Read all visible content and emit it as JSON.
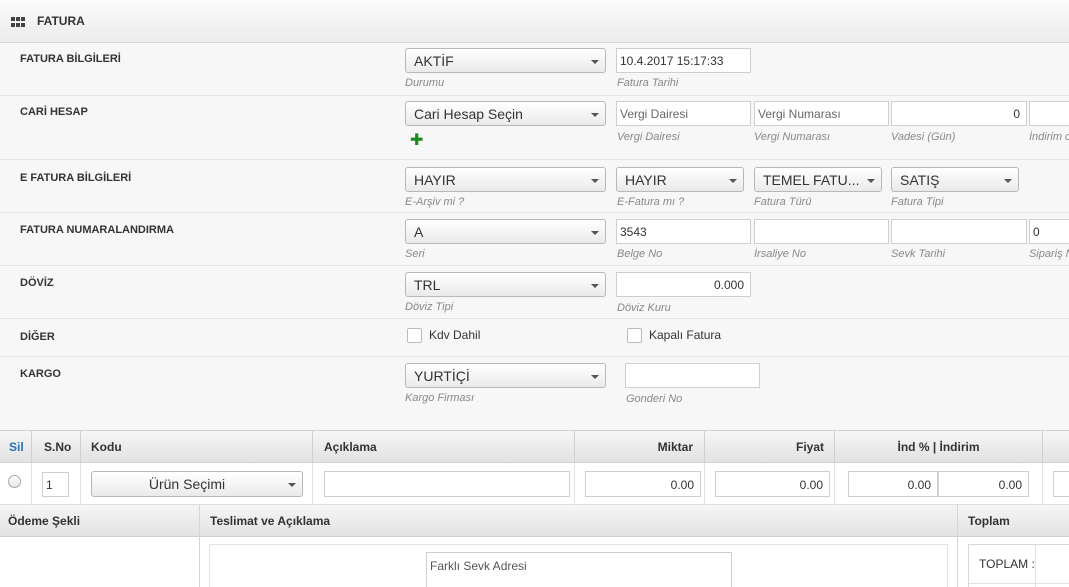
{
  "header": {
    "title": "FATURA",
    "icon": "grid-icon"
  },
  "rows": {
    "fatura_bilgileri": {
      "label": "FATURA BİLGİLERİ",
      "durum_value": "AKTİF",
      "durum_hint": "Durumu",
      "tarih_value": "10.4.2017 15:17:33",
      "tarih_hint": "Fatura Tarihi"
    },
    "cari_hesap": {
      "label": "CARİ HESAP",
      "cari_value": "Cari Hesap Seçin",
      "add_icon": "plus-icon",
      "vergi_dairesi_placeholder": "Vergi Dairesi",
      "vergi_dairesi_hint": "Vergi Dairesi",
      "vergi_no_placeholder": "Vergi Numarası",
      "vergi_no_hint": "Vergi Numarası",
      "vade_value": "0",
      "vade_hint": "Vadesi (Gün)",
      "indirim_hint": "İndirim o"
    },
    "e_fatura": {
      "label": "E FATURA BİLGİLERİ",
      "earsiv_value": "HAYIR",
      "earsiv_hint": "E-Arşiv mi ?",
      "efatura_value": "HAYIR",
      "efatura_hint": "E-Fatura mı ?",
      "tur_value": "TEMEL FATU...",
      "tur_hint": "Fatura Türü",
      "tip_value": "SATIŞ",
      "tip_hint": "Fatura Tipi"
    },
    "numaralandirma": {
      "label": "FATURA NUMARALANDIRMA",
      "seri_value": "A",
      "seri_hint": "Seri",
      "belge_value": "3543",
      "belge_hint": "Belge No",
      "irsaliye_hint": "İrsaliye No",
      "sevk_hint": "Sevk Tarihi",
      "siparis_value": "0",
      "siparis_hint": "Sipariş N"
    },
    "doviz": {
      "label": "DÖVİZ",
      "tip_value": "TRL",
      "tip_hint": "Döviz Tipi",
      "kur_value": "0.000",
      "kur_hint": "Döviz Kuru"
    },
    "diger": {
      "label": "DİĞER",
      "kdv_label": "Kdv Dahil",
      "kapali_label": "Kapalı Fatura"
    },
    "kargo": {
      "label": "KARGO",
      "firma_value": "YURTİÇİ",
      "firma_hint": "Kargo Firması",
      "gonderi_hint": "Gonderi No"
    }
  },
  "table": {
    "headers": {
      "sil": "Sil",
      "sno": "S.No",
      "kodu": "Kodu",
      "aciklama": "Açıklama",
      "miktar": "Miktar",
      "fiyat": "Fiyat",
      "indirim": "İnd % | İndirim"
    },
    "row": {
      "sno": "1",
      "urun": "Ürün Seçimi",
      "miktar": "0.00",
      "fiyat": "0.00",
      "ind_pct": "0.00",
      "indirim": "0.00"
    }
  },
  "bottom": {
    "odeme": "Ödeme Şekli",
    "teslimat": "Teslimat ve Açıklama",
    "toplam": "Toplam",
    "sevk_adresi": "Farklı Sevk Adresi",
    "toplam_label": "TOPLAM :"
  },
  "colors": {
    "accent_link": "#2a6fb4",
    "plus": "#1c8a1c"
  }
}
